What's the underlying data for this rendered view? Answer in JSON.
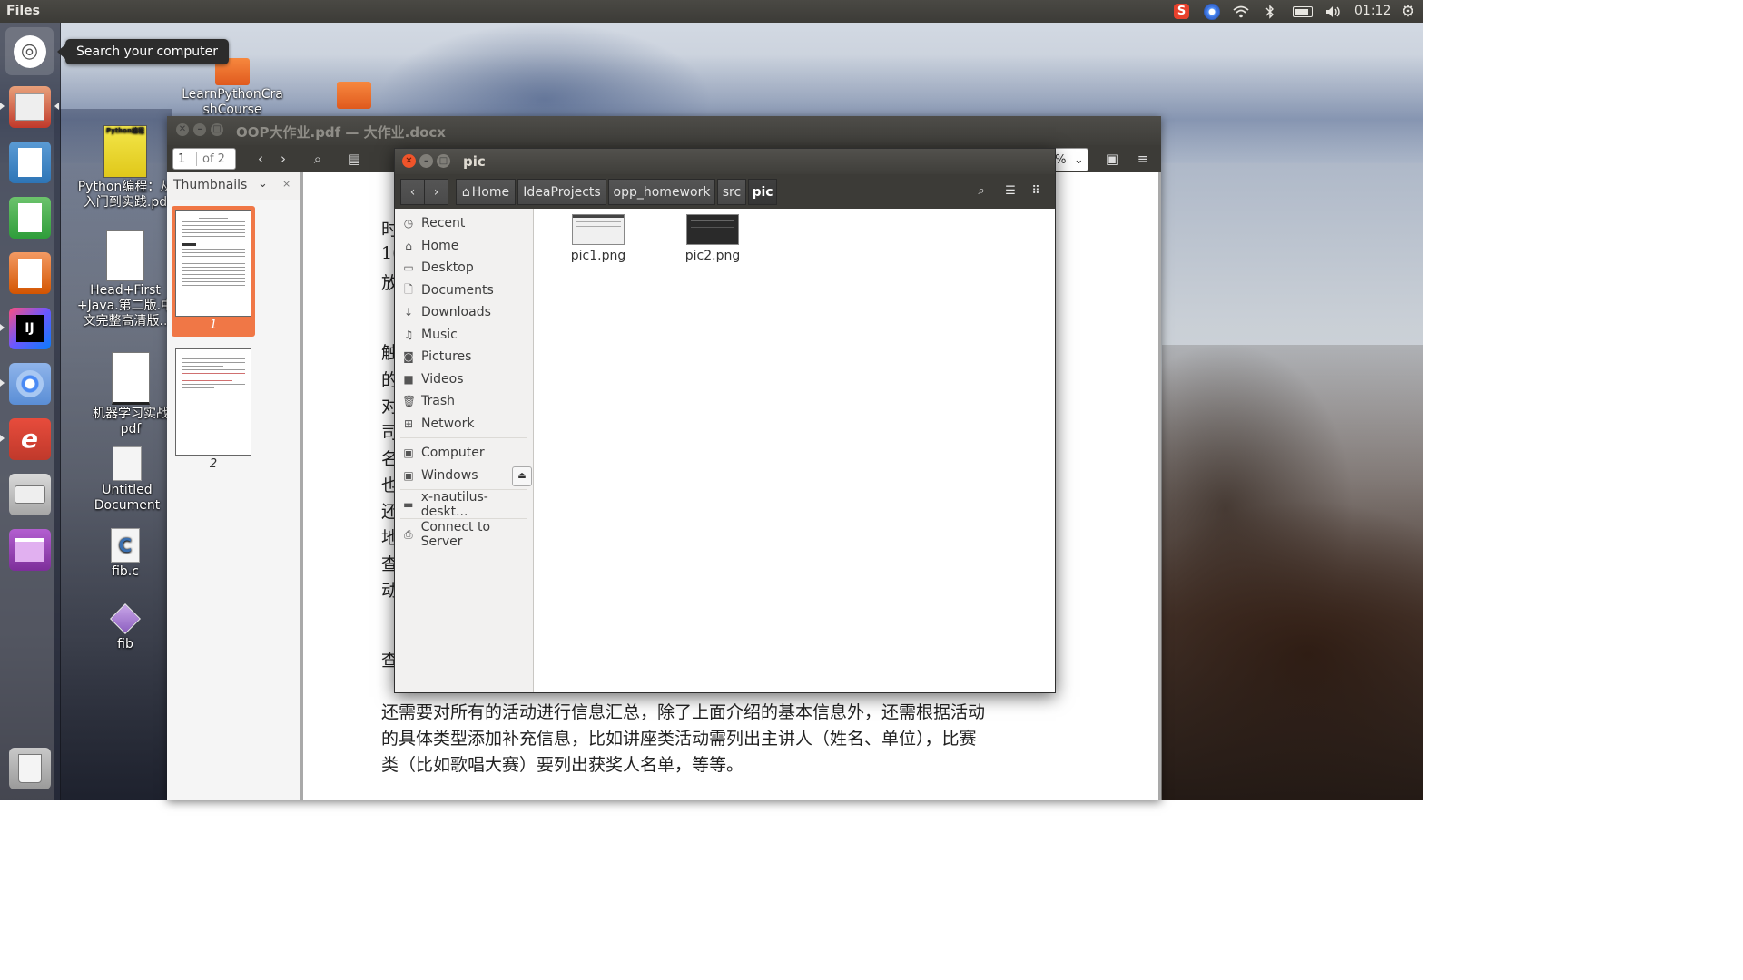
{
  "top_panel": {
    "app_name": "Files",
    "clock": "01:12",
    "tray_icons": [
      "sogou-ime-icon",
      "chromium-icon",
      "wifi-icon",
      "bluetooth-icon",
      "battery-icon",
      "volume-icon",
      "gear-icon"
    ]
  },
  "launcher": {
    "items": [
      "ubuntu-dash",
      "files",
      "writer",
      "calc",
      "impress",
      "intellij-idea",
      "chromium",
      "text-editor",
      "disk",
      "videos",
      "trash"
    ],
    "tooltip": "Search your computer"
  },
  "desktop_icons": [
    {
      "label_lines": [
        "LearnPythonCra",
        "shCourse"
      ]
    },
    {
      "label_lines": [
        "Python编程：从",
        "入门到实践.pd"
      ]
    },
    {
      "label_lines": [
        "Head+First",
        "+Java.第二版.中",
        "文完整高清版.."
      ]
    },
    {
      "label_lines": [
        "机器学习实战",
        "pdf"
      ]
    },
    {
      "label_lines": [
        "Untitled",
        "Document"
      ]
    },
    {
      "label_lines": [
        "fib.c"
      ]
    },
    {
      "label_lines": [
        "fib"
      ]
    }
  ],
  "evince": {
    "title": "OOP大作业.pdf — 大作业.docx",
    "page_current": "1",
    "page_total": "of 2",
    "zoom": "%",
    "sidebar_mode": "Thumbnails",
    "thumbnails": [
      "1",
      "2"
    ],
    "doc_side_chars": [
      "时",
      "1(",
      "放",
      "触",
      "的",
      "对",
      "司",
      "名",
      "也",
      "还",
      "地",
      "查",
      "动",
      "查"
    ],
    "doc_lines": [
      "还需要对所有的活动进行信息汇总，除了上面介绍的基本信息外，还需根据活动",
      "的具体类型添加补充信息，比如讲座类活动需列出主讲人（姓名、单位），比赛",
      "类（比如歌唱大赛）要列出获奖人名单，等等。"
    ]
  },
  "nautilus": {
    "title": "pic",
    "breadcrumbs": [
      "Home",
      "IdeaProjects",
      "opp_homework",
      "src",
      "pic"
    ],
    "places": [
      {
        "icon": "clock-icon",
        "label": "Recent"
      },
      {
        "icon": "home-icon",
        "label": "Home"
      },
      {
        "icon": "desktop-icon",
        "label": "Desktop"
      },
      {
        "icon": "document-icon",
        "label": "Documents"
      },
      {
        "icon": "download-icon",
        "label": "Downloads"
      },
      {
        "icon": "music-icon",
        "label": "Music"
      },
      {
        "icon": "camera-icon",
        "label": "Pictures"
      },
      {
        "icon": "video-icon",
        "label": "Videos"
      },
      {
        "icon": "trash-icon",
        "label": "Trash"
      },
      {
        "icon": "network-icon",
        "label": "Network"
      }
    ],
    "devices": [
      {
        "icon": "computer-icon",
        "label": "Computer"
      },
      {
        "icon": "drive-icon",
        "label": "Windows"
      }
    ],
    "other": [
      {
        "icon": "folder-icon",
        "label": "x-nautilus-deskt..."
      },
      {
        "icon": "server-icon",
        "label": "Connect to Server"
      }
    ],
    "files": [
      {
        "name": "pic1.png",
        "thumb_color": "#f0f0f0"
      },
      {
        "name": "pic2.png",
        "thumb_color": "#2a2a2a"
      }
    ]
  },
  "colors": {
    "accent": "#e95420",
    "panel": "#3c3b37",
    "close_button": "#f0542a"
  }
}
